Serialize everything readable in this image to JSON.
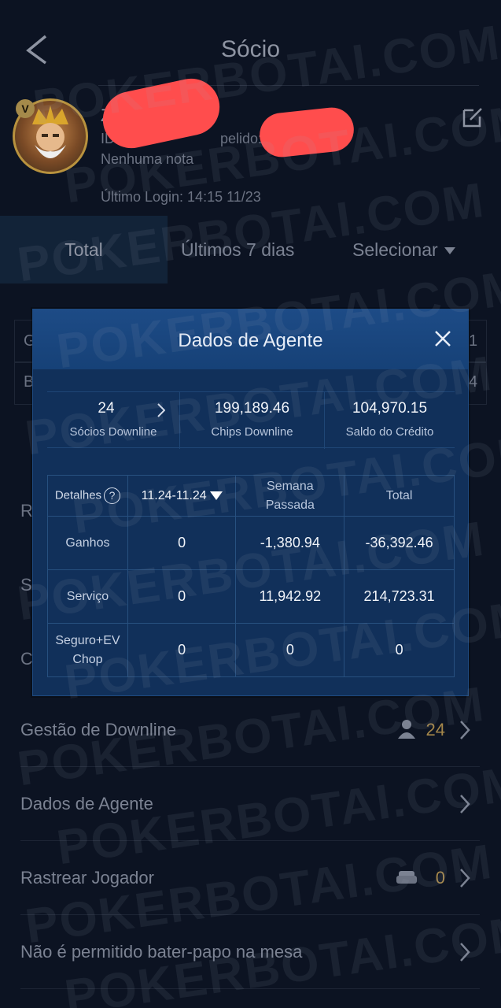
{
  "header": {
    "title": "Sócio"
  },
  "profile": {
    "name": "Z            o",
    "id_text": "ID: 3",
    "nickname_text": "pelido: ",
    "note": "Nenhuma nota",
    "last_login": "Último Login: 14:15 11/23",
    "badge": "V"
  },
  "tabs": [
    {
      "label": "Total"
    },
    {
      "label": "Últimos 7 dias"
    },
    {
      "label": "Selecionar"
    }
  ],
  "ghost": {
    "a": "G",
    "b": "B",
    "c": "R",
    "d": "S",
    "e": "C",
    "n1": "1",
    "n4": "4"
  },
  "menu": [
    {
      "label": "Gestão de Downline",
      "count": "24",
      "icon": "person-icon"
    },
    {
      "label": "Dados de Agente"
    },
    {
      "label": "Rastrear Jogador",
      "count": "0",
      "icon": "sofa-icon"
    },
    {
      "label": "Não é permitido bater-papo na mesa"
    }
  ],
  "modal": {
    "title": "Dados de Agente",
    "summary": [
      {
        "value": "24",
        "label": "Sócios Downline"
      },
      {
        "value": "199,189.46",
        "label": "Chips Downline"
      },
      {
        "value": "104,970.15",
        "label": "Saldo do Crédito"
      }
    ],
    "table": {
      "details_label": "Detalhes",
      "date_range": "11.24-11.24",
      "col_week_line1": "Semana",
      "col_week_line2": "Passada",
      "col_total": "Total",
      "rows": [
        {
          "label_line1": "Ganhos",
          "label_line2": "",
          "day": "0",
          "week": "-1,380.94",
          "total": "-36,392.46"
        },
        {
          "label_line1": "Serviço",
          "label_line2": "",
          "day": "0",
          "week": "11,942.92",
          "total": "214,723.31"
        },
        {
          "label_line1": "Seguro+EV",
          "label_line2": "Chop",
          "day": "0",
          "week": "0",
          "total": "0"
        }
      ]
    }
  },
  "watermark": "POKERBOTAI.COM",
  "colors": {
    "background": "#0c1322",
    "modal": "#11305a",
    "accent_gold": "#a5874a",
    "redaction": "#ff4d4d"
  }
}
